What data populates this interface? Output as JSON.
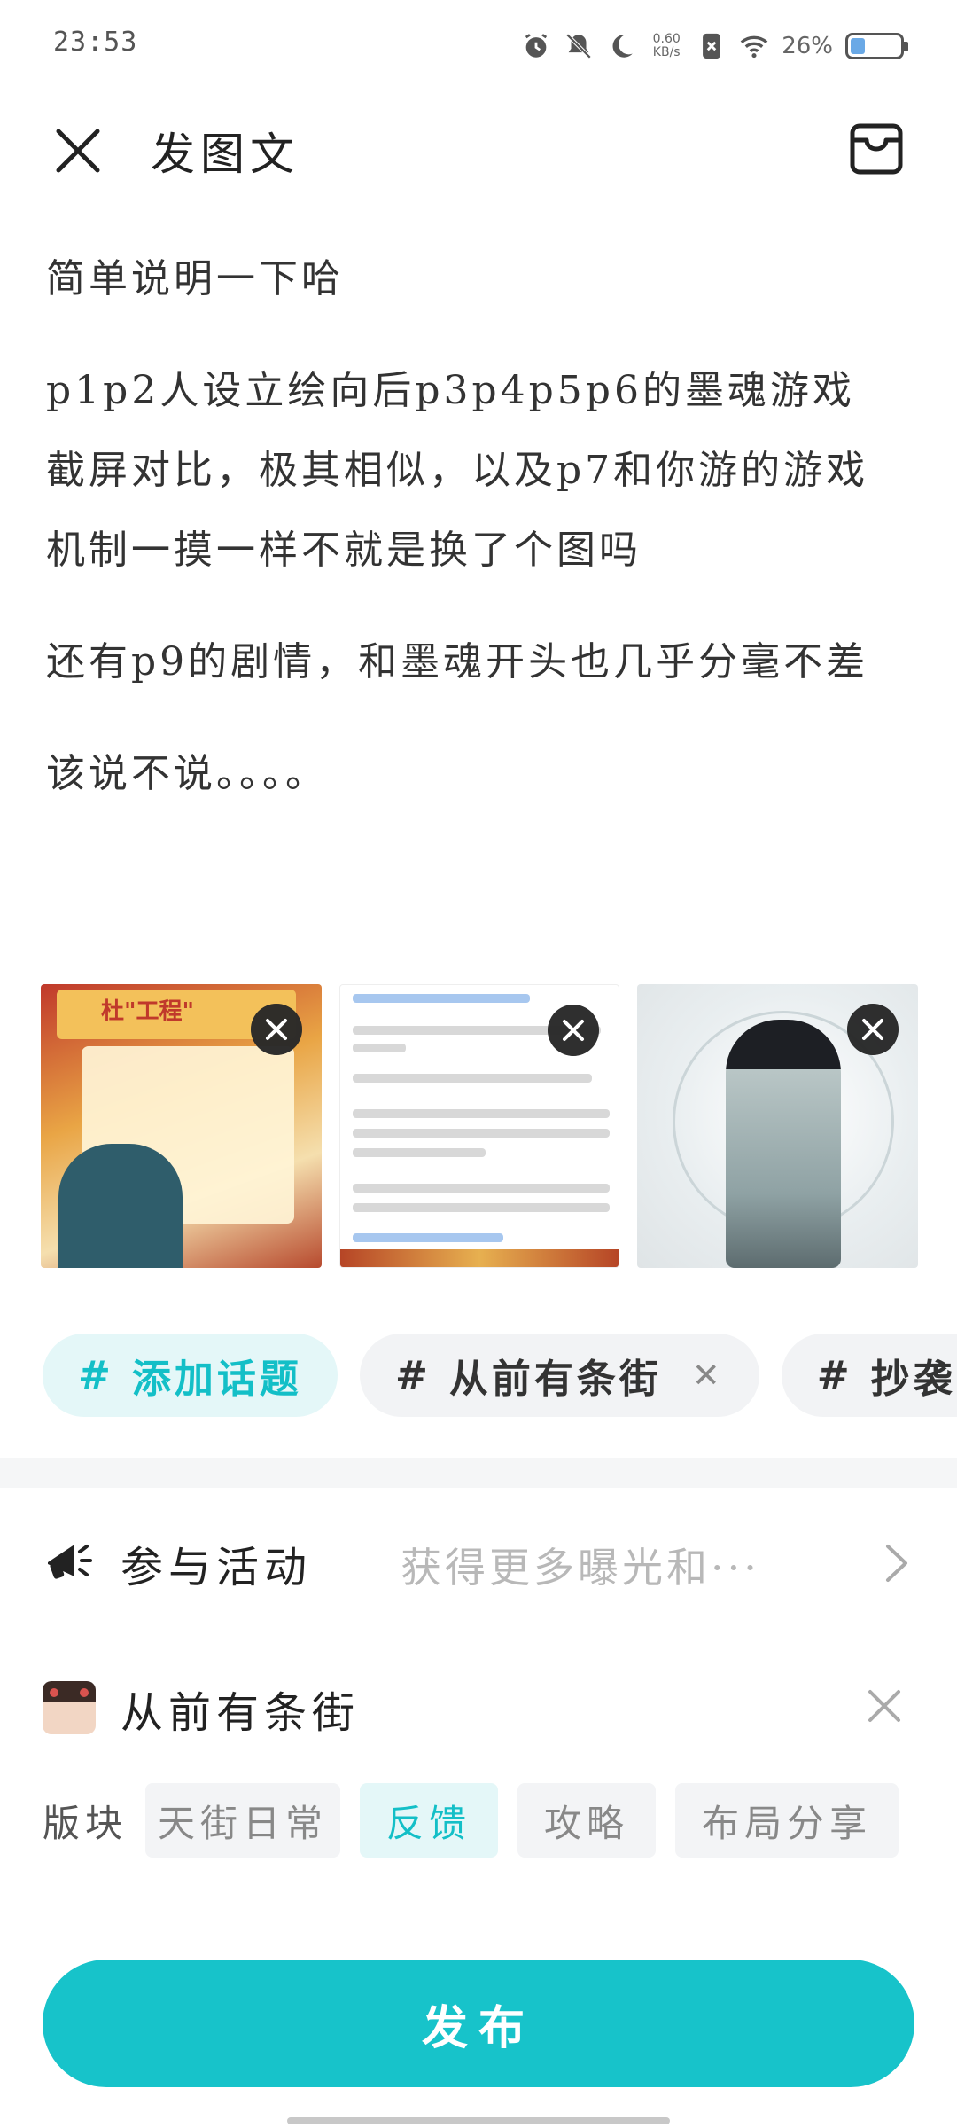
{
  "status_bar": {
    "time": "23:53",
    "net_speed": "0.60\nKB/s",
    "battery_percent": "26%",
    "battery_level": 0.26
  },
  "header": {
    "title": "发图文"
  },
  "post": {
    "paragraphs": [
      "简单说明一下哈",
      "p1p2人设立绘向后p3p4p5p6的墨魂游戏截屏对比，极其相似，以及p7和你游的游戏机制一摸一样不就是换了个图吗",
      "还有p9的剧情，和墨魂开头也几乎分毫不差",
      "该说不说。。。。"
    ]
  },
  "images": {
    "thumb1_banner": "杜\"工程\"",
    "thumb2_lines": 9
  },
  "topics": {
    "add_label": "添加话题",
    "hash": "#",
    "items": [
      {
        "label": "从前有条街"
      },
      {
        "label": "抄袭"
      }
    ]
  },
  "activity": {
    "label": "参与活动",
    "hint": "获得更多曝光和···"
  },
  "community": {
    "name": "从前有条街"
  },
  "sections": {
    "label": "版块",
    "items": [
      "天街日常",
      "反馈",
      "攻略",
      "布局分享"
    ],
    "active": "反馈"
  },
  "publish": {
    "label": "发布"
  },
  "colors": {
    "accent": "#17c3ca",
    "accent_light": "#e4f7f8"
  }
}
